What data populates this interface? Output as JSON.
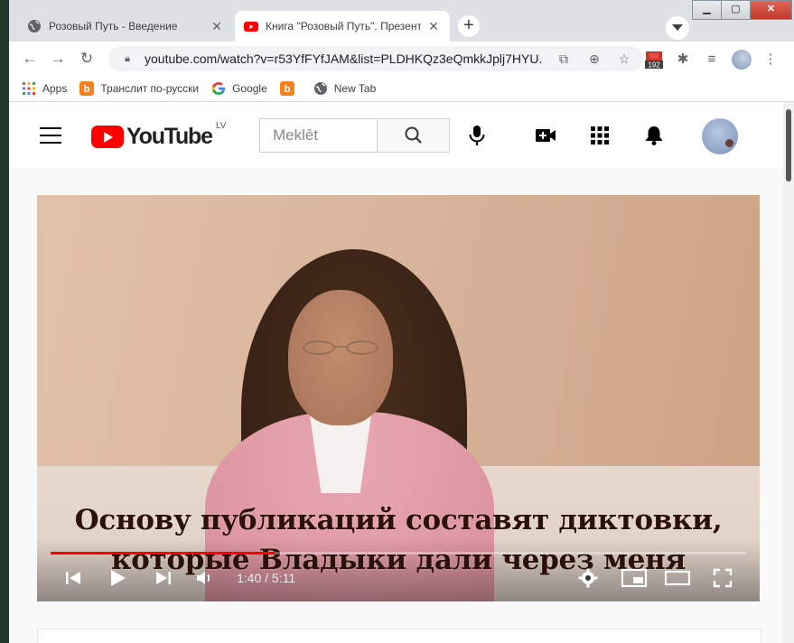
{
  "browser": {
    "tabs": [
      {
        "title": "Розовый Путь - Введение",
        "active": false,
        "favicon": "globe-icon"
      },
      {
        "title": "Книга \"Розовый Путь\". Презентация",
        "active": true,
        "favicon": "youtube-icon"
      }
    ],
    "new_tab_symbol": "+",
    "window_controls": {
      "minimize": "▁",
      "maximize": "▢",
      "close": "✕"
    },
    "url": "youtube.com/watch?v=r53YfFYfJAM&list=PLDHKQz3eQmkkJplj7HYU...",
    "extension_badge": "192",
    "bookmarks": [
      {
        "label": "Apps",
        "icon": "apps-grid-icon"
      },
      {
        "label": "Транслит по-русски",
        "icon": "translit-icon"
      },
      {
        "label": "Google",
        "icon": "google-icon"
      },
      {
        "label": "",
        "icon": "translit-icon"
      },
      {
        "label": "New Tab",
        "icon": "globe-icon"
      }
    ]
  },
  "youtube": {
    "logo_text": "YouTube",
    "region": "LV",
    "search_placeholder": "Meklēt"
  },
  "video": {
    "subtitle_line1": "Основу публикаций составят диктовки,",
    "subtitle_line2": "которые Владыки дали через меня",
    "time_display": "1:40 / 5:11",
    "progress_played": 0.322,
    "progress_loaded": 0.0
  },
  "colors": {
    "accent": "#ff0000",
    "tabstrip": "#dee1e6"
  }
}
